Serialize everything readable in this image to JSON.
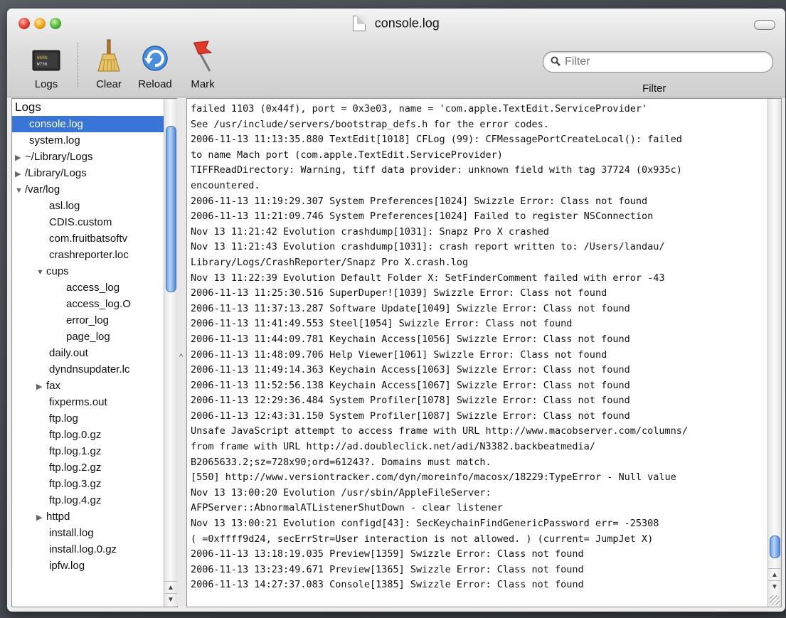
{
  "window": {
    "title": "console.log"
  },
  "toolbar": {
    "logs_label": "Logs",
    "clear_label": "Clear",
    "reload_label": "Reload",
    "mark_label": "Mark",
    "filter_label": "Filter",
    "filter_placeholder": "Filter"
  },
  "sidebar": {
    "header": "Logs",
    "items": [
      {
        "label": "console.log"
      },
      {
        "label": "system.log"
      },
      {
        "label": "~/Library/Logs"
      },
      {
        "label": "/Library/Logs"
      },
      {
        "label": "/var/log"
      },
      {
        "label": "asl.log"
      },
      {
        "label": "CDIS.custom"
      },
      {
        "label": "com.fruitbatsoftv"
      },
      {
        "label": "crashreporter.loc"
      },
      {
        "label": "cups"
      },
      {
        "label": "access_log"
      },
      {
        "label": "access_log.O"
      },
      {
        "label": "error_log"
      },
      {
        "label": "page_log"
      },
      {
        "label": "daily.out"
      },
      {
        "label": "dyndnsupdater.lc"
      },
      {
        "label": "fax"
      },
      {
        "label": "fixperms.out"
      },
      {
        "label": "ftp.log"
      },
      {
        "label": "ftp.log.0.gz"
      },
      {
        "label": "ftp.log.1.gz"
      },
      {
        "label": "ftp.log.2.gz"
      },
      {
        "label": "ftp.log.3.gz"
      },
      {
        "label": "ftp.log.4.gz"
      },
      {
        "label": "httpd"
      },
      {
        "label": "install.log"
      },
      {
        "label": "install.log.0.gz"
      },
      {
        "label": "ipfw.log"
      }
    ]
  },
  "log": {
    "lines": [
      "failed 1103 (0x44f), port = 0x3e03, name = 'com.apple.TextEdit.ServiceProvider'",
      "See /usr/include/servers/bootstrap_defs.h for the error codes.",
      "2006-11-13 11:13:35.880 TextEdit[1018] CFLog (99): CFMessagePortCreateLocal(): failed",
      "to name Mach port (com.apple.TextEdit.ServiceProvider)",
      "TIFFReadDirectory: Warning, tiff data provider: unknown field with tag 37724 (0x935c)",
      "encountered.",
      "2006-11-13 11:19:29.307 System Preferences[1024] Swizzle Error: Class not found",
      "2006-11-13 11:21:09.746 System Preferences[1024] Failed to register NSConnection",
      "Nov 13 11:21:42 Evolution crashdump[1031]: Snapz Pro X crashed",
      "Nov 13 11:21:43 Evolution crashdump[1031]: crash report written to: /Users/landau/",
      "Library/Logs/CrashReporter/Snapz Pro X.crash.log",
      "Nov 13 11:22:39 Evolution Default Folder X: SetFinderComment failed with error -43",
      "2006-11-13 11:25:30.516 SuperDuper![1039] Swizzle Error: Class not found",
      "2006-11-13 11:37:13.287 Software Update[1049] Swizzle Error: Class not found",
      "2006-11-13 11:41:49.553 Steel[1054] Swizzle Error: Class not found",
      "2006-11-13 11:44:09.781 Keychain Access[1056] Swizzle Error: Class not found",
      "2006-11-13 11:48:09.706 Help Viewer[1061] Swizzle Error: Class not found",
      "2006-11-13 11:49:14.363 Keychain Access[1063] Swizzle Error: Class not found",
      "2006-11-13 11:52:56.138 Keychain Access[1067] Swizzle Error: Class not found",
      "2006-11-13 12:29:36.484 System Profiler[1078] Swizzle Error: Class not found",
      "2006-11-13 12:43:31.150 System Profiler[1087] Swizzle Error: Class not found",
      "Unsafe JavaScript attempt to access frame with URL http://www.macobserver.com/columns/",
      "from frame with URL http://ad.doubleclick.net/adi/N3382.backbeatmedia/",
      "B2065633.2;sz=728x90;ord=61243?. Domains must match.",
      "[550] http://www.versiontracker.com/dyn/moreinfo/macosx/18229:TypeError - Null value",
      "Nov 13 13:00:20 Evolution /usr/sbin/AppleFileServer:",
      "AFPServer::AbnormalATListenerShutDown - clear listener",
      "Nov 13 13:00:21 Evolution configd[43]: SecKeychainFindGenericPassword err= -25308",
      "( =0xffff9d24, secErrStr=User interaction is not allowed. ) (current= JumpJet X)",
      "2006-11-13 13:18:19.035 Preview[1359] Swizzle Error: Class not found",
      "2006-11-13 13:23:49.671 Preview[1365] Swizzle Error: Class not found",
      "2006-11-13 14:27:37.083 Console[1385] Swizzle Error: Class not found"
    ]
  }
}
